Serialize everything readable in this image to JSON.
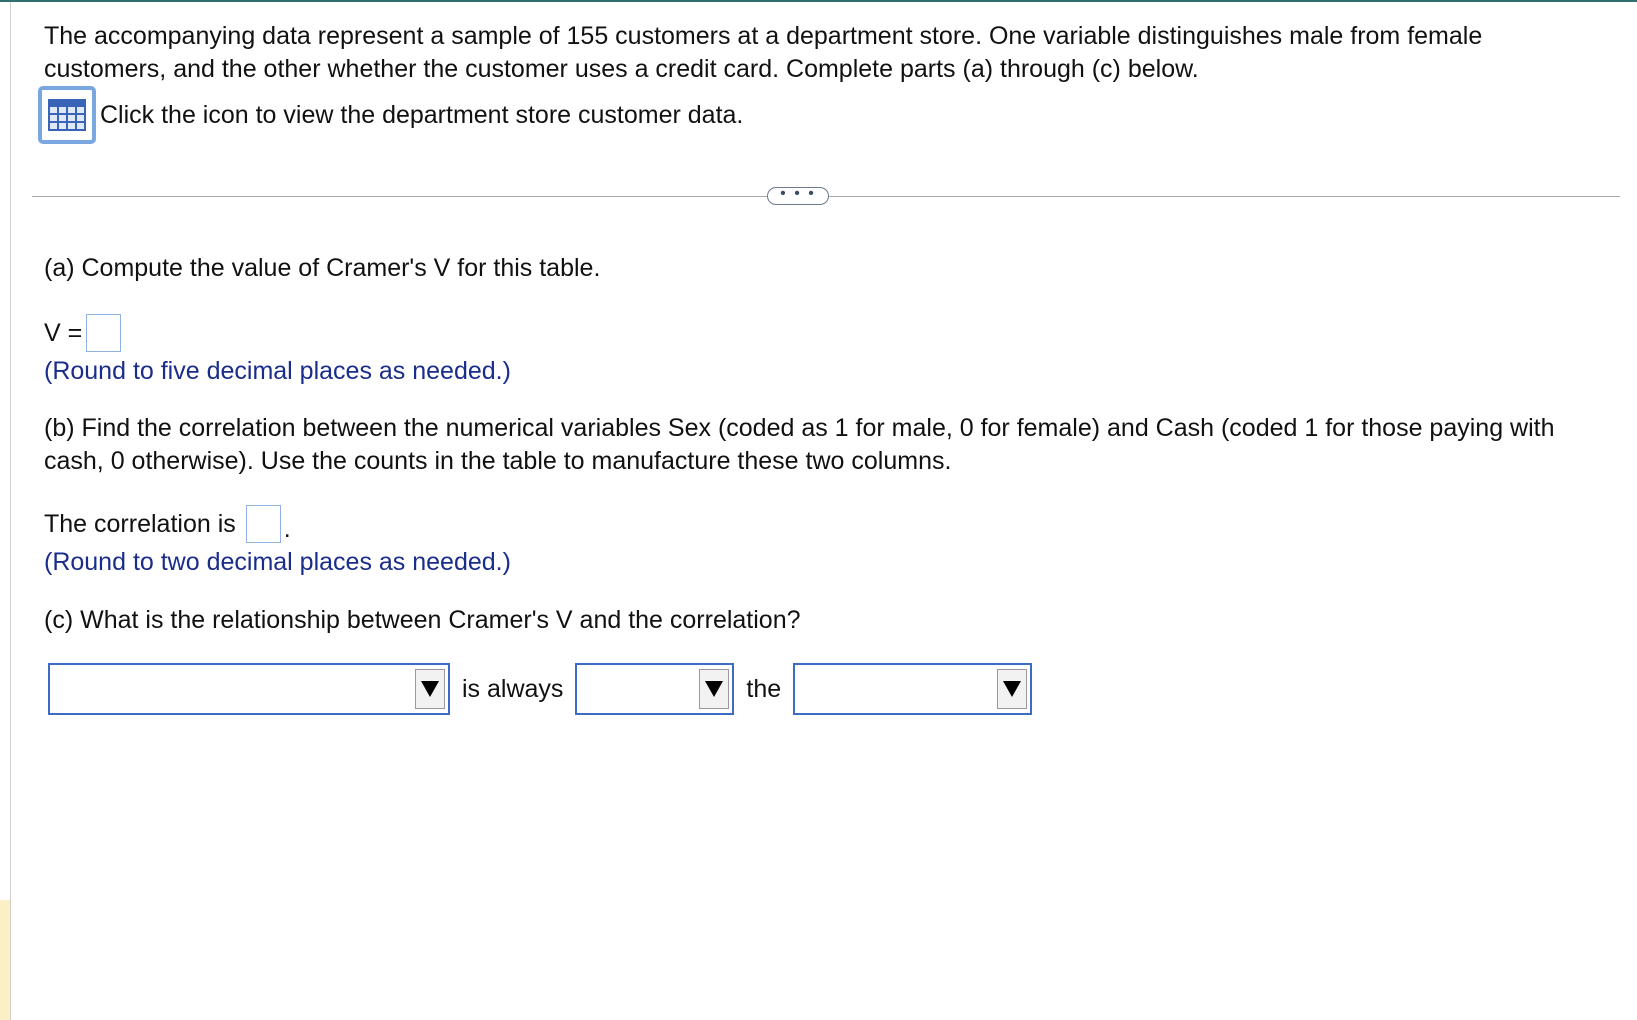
{
  "intro": {
    "text": "The accompanying data represent a sample of 155 customers at a department store. One variable distinguishes male from female customers, and the other whether the customer uses a credit card. Complete parts (a) through (c) below."
  },
  "data_link": {
    "icon": "table-grid-icon",
    "label": "Click the icon to view the department store customer data."
  },
  "more_button": {
    "label": "• • •"
  },
  "part_a": {
    "question": "(a) Compute the value of Cramer's V for this table.",
    "answer_label": "V =",
    "answer_value": "",
    "hint": "(Round to five decimal places as needed.)"
  },
  "part_b": {
    "question": "(b) Find the correlation between the numerical variables Sex (coded as 1 for male, 0 for female) and Cash (coded 1 for those paying with cash, 0 otherwise). Use the counts in the table to manufacture these two columns.",
    "answer_label": "The correlation is",
    "answer_value": "",
    "answer_suffix": ".",
    "hint": "(Round to two decimal places as needed.)"
  },
  "part_c": {
    "question": "(c) What is the relationship between Cramer's V and the correlation?",
    "select1_value": "",
    "connector1": "is always",
    "select2_value": "",
    "connector2": "the",
    "select3_value": ""
  },
  "colors": {
    "hint_text": "#1a2d8a",
    "select_border": "#3d6cc4",
    "answer_box_border": "#8fb3e0",
    "icon_border": "#7aa7e0",
    "icon_grid": "#3a64b8"
  }
}
